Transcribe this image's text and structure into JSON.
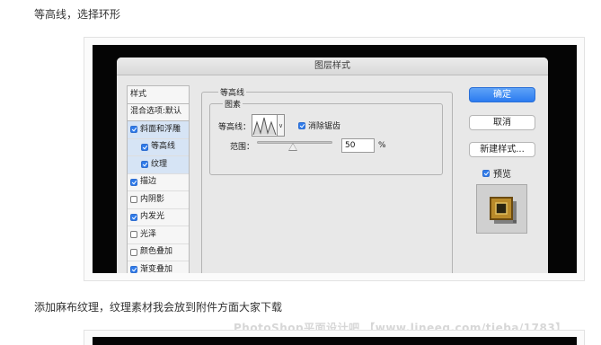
{
  "article": {
    "intro_text": "等高线，选择环形",
    "outro_text": "添加麻布纹理，纹理素材我会放到附件方面大家下载",
    "watermark": "PhotoShop平面设计吧 【www.lineeg.com/tieba/1783】"
  },
  "dialog": {
    "title": "图层样式",
    "styles_list": [
      {
        "label": "样式",
        "checkbox": false,
        "checked": false,
        "selected": false,
        "indent": false,
        "header": true
      },
      {
        "label": "混合选项:默认",
        "checkbox": false,
        "checked": false,
        "selected": false,
        "indent": false,
        "header": true
      },
      {
        "label": "斜面和浮雕",
        "checkbox": true,
        "checked": true,
        "selected": true,
        "indent": false
      },
      {
        "label": "等高线",
        "checkbox": true,
        "checked": true,
        "selected": true,
        "indent": true
      },
      {
        "label": "纹理",
        "checkbox": true,
        "checked": true,
        "selected": true,
        "indent": true
      },
      {
        "label": "描边",
        "checkbox": true,
        "checked": true,
        "selected": false,
        "indent": false
      },
      {
        "label": "内阴影",
        "checkbox": true,
        "checked": false,
        "selected": false,
        "indent": false
      },
      {
        "label": "内发光",
        "checkbox": true,
        "checked": true,
        "selected": false,
        "indent": false
      },
      {
        "label": "光泽",
        "checkbox": true,
        "checked": false,
        "selected": false,
        "indent": false
      },
      {
        "label": "颜色叠加",
        "checkbox": true,
        "checked": false,
        "selected": false,
        "indent": false
      },
      {
        "label": "渐变叠加",
        "checkbox": true,
        "checked": true,
        "selected": false,
        "indent": false
      }
    ],
    "panel": {
      "group_title": "等高线",
      "subgroup_title": "图素",
      "contour_label": "等高线：",
      "antialias_label": "消除锯齿",
      "antialias_checked": true,
      "range_label": "范围：",
      "range_value": "50",
      "range_unit": "%",
      "range_slider_fraction": 0.5
    },
    "buttons": {
      "ok": "确定",
      "cancel": "取消",
      "new_style": "新建样式...",
      "preview_label": "预览",
      "preview_checked": true
    }
  },
  "colors": {
    "accent": "#2f7bea",
    "selection": "#d6e4f5",
    "background_dark": "#050505"
  }
}
